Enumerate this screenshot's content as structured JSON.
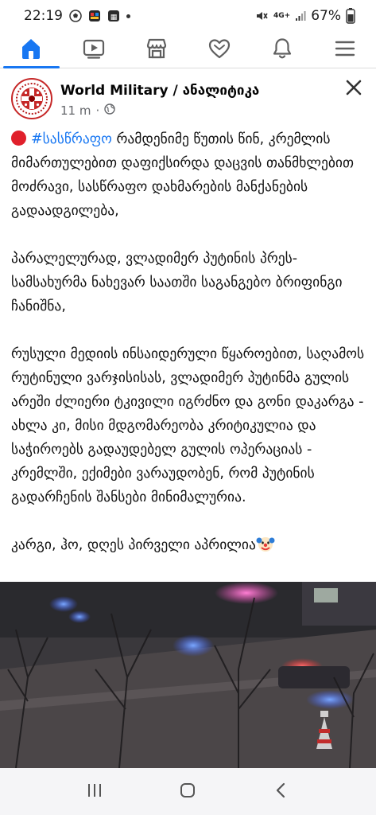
{
  "status": {
    "time": "22:19",
    "battery": "67%",
    "network": "4G+"
  },
  "nav": {
    "items": [
      {
        "name": "home",
        "active": true
      },
      {
        "name": "watch",
        "active": false
      },
      {
        "name": "marketplace",
        "active": false
      },
      {
        "name": "dating",
        "active": false
      },
      {
        "name": "notifications",
        "active": false
      },
      {
        "name": "menu",
        "active": false
      }
    ]
  },
  "post": {
    "page_name": "World Military / ანალიტიკა",
    "time_ago": "11 m",
    "separator": "·",
    "hashtag": "#სასწრაფო",
    "para1_rest": " რამდენიმე წუთის წინ, კრემლის მიმართულებით დაფიქსირდა დაცვის თანმხლებით მოძრავი, სასწრაფო დახმარების მანქანების გადაადგილება,",
    "para2": "პარალელურად, ვლადიმერ პუტინის პრეს-სამსახურმა ნახევარ საათში საგანგებო ბრიფინგი ჩანიშნა,",
    "para3": "რუსული მედიის ინსაიდერული წყაროებით, საღამოს რუტინული ვარჯისისას, ვლადიმერ პუტინმა გულის არეში ძლიერი ტკივილი იგრძნო და გონი დაკარგა - ახლა კი, მისი მდგომარეობა კრიტიკულია და საჭიროებს გადაუდებელ გულის ოპერაციას - კრემლში, ექიმები ვარაუდობენ, რომ პუტინის გადარჩენის შანსები მინიმალურია.",
    "para4": "კარგი, ჰო, დღეს პირველი აპრილია"
  },
  "colors": {
    "accent": "#1877f2",
    "hashtag": "#1877f2",
    "alert_red": "#e0202b"
  }
}
